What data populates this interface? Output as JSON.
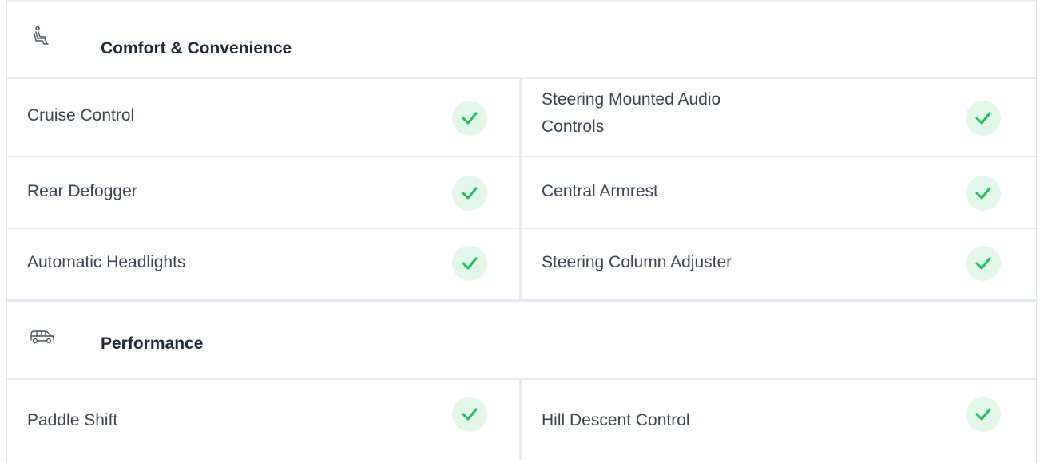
{
  "sections": [
    {
      "title": "Comfort & Convenience",
      "icon": "car-seat-icon",
      "rows": [
        {
          "left": "Cruise Control",
          "left_available": true,
          "right": "Steering Mounted Audio Controls",
          "right_line1": "Steering Mounted Audio",
          "right_line2": "Controls",
          "right_available": true
        },
        {
          "left": "Rear Defogger",
          "left_available": true,
          "right": "Central Armrest",
          "right_available": true
        },
        {
          "left": "Automatic Headlights",
          "left_available": true,
          "right": "Steering Column Adjuster",
          "right_available": true
        }
      ]
    },
    {
      "title": "Performance",
      "icon": "car-engine-icon",
      "rows": [
        {
          "left": "Paddle Shift",
          "left_available": true,
          "right": "Hill Descent Control",
          "right_available": true
        }
      ]
    }
  ],
  "colors": {
    "check": "#1fbf5f",
    "check_bg": "#e3f6ea",
    "border": "#e6eaee",
    "heading": "#1f2937",
    "text": "#3b4251"
  }
}
